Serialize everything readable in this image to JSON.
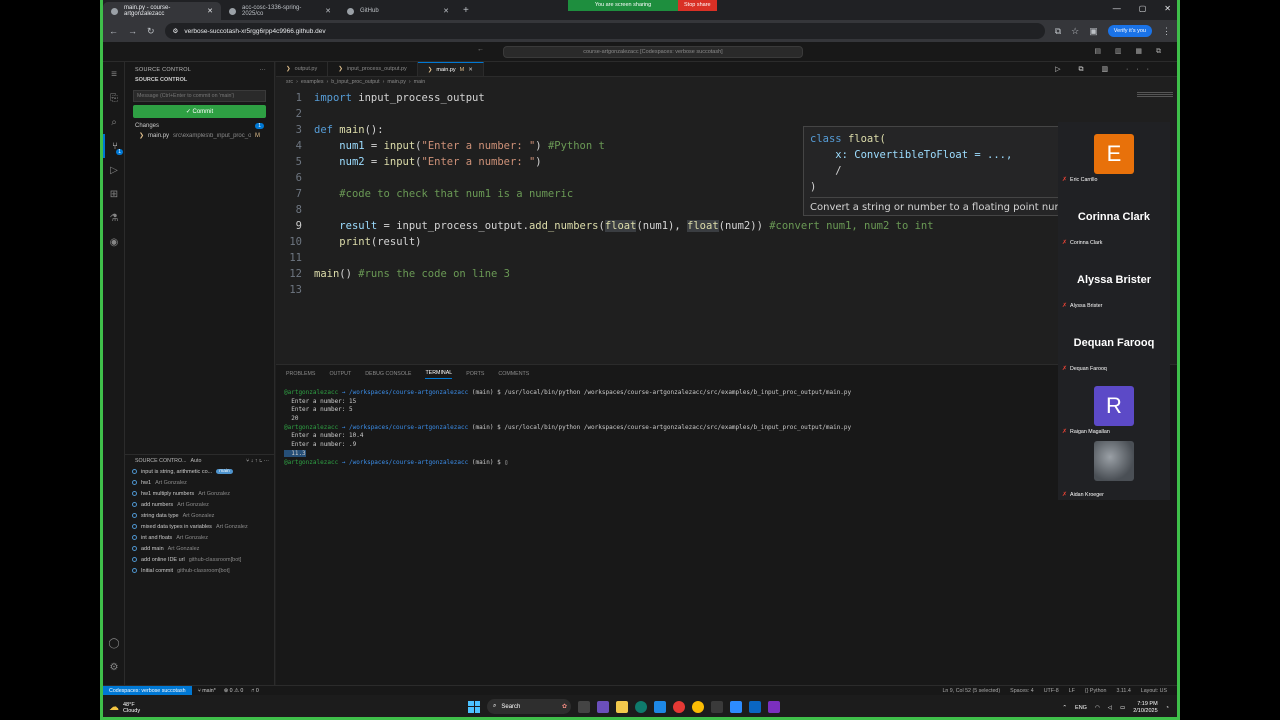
{
  "browser": {
    "tabs": [
      {
        "title": "main.py - course-artgonzalezacc",
        "active": true
      },
      {
        "title": "acc-cosc-1336-spring-2025/co",
        "active": false
      },
      {
        "title": "GitHub",
        "active": false
      }
    ],
    "share_text": "You are screen sharing",
    "stop_share": "Stop share",
    "url": "verbose-succotash-xr5rgg6rpp4c9966.github.dev",
    "verify": "Verify it's you"
  },
  "vscode": {
    "command_center": "course-artgonzalezacc [Codespaces: verbose succotash]",
    "source_control": {
      "header": "SOURCE CONTROL",
      "sub_header": "SOURCE CONTROL",
      "message_placeholder": "Message (Ctrl+Enter to commit on 'main')",
      "commit_label": "✓ Commit",
      "changes_label": "Changes",
      "changes_count": "1",
      "file_name": "main.py",
      "file_path": "src\\examples\\b_input_proc_out...",
      "file_status": "M"
    },
    "graph": {
      "header": "SOURCE CONTRO...",
      "auto_label": "Auto",
      "commits": [
        {
          "msg": "input is string, arithmetic co...",
          "author": "",
          "tag": "main"
        },
        {
          "msg": "hw1",
          "author": "Art Gonzalez",
          "tag": ""
        },
        {
          "msg": "hw1 multiply numbers",
          "author": "Art Gonzalez",
          "tag": ""
        },
        {
          "msg": "add numbers",
          "author": "Art Gonzalez",
          "tag": ""
        },
        {
          "msg": "string data type",
          "author": "Art Gonzalez",
          "tag": ""
        },
        {
          "msg": "mixed data types in variables",
          "author": "Art Gonzalez",
          "tag": ""
        },
        {
          "msg": "int and floats",
          "author": "Art Gonzalez",
          "tag": ""
        },
        {
          "msg": "add main",
          "author": "Art Gonzalez",
          "tag": ""
        },
        {
          "msg": "add online IDE url",
          "author": "github-classroom[bot]",
          "tag": ""
        },
        {
          "msg": "Initial commit",
          "author": "github-classroom[bot]",
          "tag": ""
        }
      ]
    },
    "editor_tabs": [
      {
        "label": "output.py",
        "modified": "",
        "active": false
      },
      {
        "label": "input_process_output.py",
        "modified": "",
        "active": false
      },
      {
        "label": "main.py",
        "modified": "M",
        "active": true
      }
    ],
    "breadcrumbs": [
      "src",
      "examples",
      "b_input_proc_output",
      "main.py",
      "main"
    ],
    "code_lines": [
      {
        "n": "1",
        "tokens": [
          [
            "kw",
            "import "
          ],
          [
            "tx",
            "input_process_output"
          ]
        ]
      },
      {
        "n": "2",
        "tokens": []
      },
      {
        "n": "3",
        "tokens": [
          [
            "kw",
            "def "
          ],
          [
            "fn",
            "main"
          ],
          [
            "tx",
            "():"
          ]
        ]
      },
      {
        "n": "4",
        "tokens": [
          [
            "tx",
            "    "
          ],
          [
            "vr",
            "num1"
          ],
          [
            "tx",
            " = "
          ],
          [
            "fn",
            "input"
          ],
          [
            "tx",
            "("
          ],
          [
            "st",
            "\"Enter a number: \""
          ],
          [
            "tx",
            ") "
          ],
          [
            "cm",
            "#Python t"
          ]
        ]
      },
      {
        "n": "5",
        "tokens": [
          [
            "tx",
            "    "
          ],
          [
            "vr",
            "num2"
          ],
          [
            "tx",
            " = "
          ],
          [
            "fn",
            "input"
          ],
          [
            "tx",
            "("
          ],
          [
            "st",
            "\"Enter a number: \""
          ],
          [
            "tx",
            ")"
          ]
        ]
      },
      {
        "n": "6",
        "tokens": []
      },
      {
        "n": "7",
        "tokens": [
          [
            "tx",
            "    "
          ],
          [
            "cm",
            "#code to check that num1 is a numeric"
          ]
        ]
      },
      {
        "n": "8",
        "tokens": []
      },
      {
        "n": "9",
        "tokens": [
          [
            "tx",
            "    "
          ],
          [
            "vr",
            "result"
          ],
          [
            "tx",
            " = "
          ],
          [
            "tx",
            "input_process_output"
          ],
          [
            "tx",
            "."
          ],
          [
            "fn",
            "add_numbers"
          ],
          [
            "tx",
            "("
          ],
          [
            "hl",
            "float"
          ],
          [
            "tx",
            "(num1), "
          ],
          [
            "hl",
            "float"
          ],
          [
            "tx",
            "(num2)) "
          ],
          [
            "cm",
            "#convert num1, num2 to int"
          ]
        ]
      },
      {
        "n": "10",
        "tokens": [
          [
            "tx",
            "    "
          ],
          [
            "fn",
            "print"
          ],
          [
            "tx",
            "(result)"
          ]
        ]
      },
      {
        "n": "11",
        "tokens": []
      },
      {
        "n": "12",
        "tokens": [
          [
            "fn",
            "main"
          ],
          [
            "tx",
            "() "
          ],
          [
            "cm",
            "#runs the code on line 3"
          ]
        ]
      },
      {
        "n": "13",
        "tokens": []
      }
    ],
    "hover": {
      "sig_lines": [
        "class float(",
        "    x: ConvertibleToFloat = ...,",
        "    /",
        ")"
      ],
      "doc": "Convert a string or number to a floating point number, if possible."
    },
    "panel_tabs": [
      "PROBLEMS",
      "OUTPUT",
      "DEBUG CONSOLE",
      "TERMINAL",
      "PORTS",
      "COMMENTS"
    ],
    "terminal": [
      {
        "user": "@artgonzalezacc",
        "path": "→ /workspaces/course-artgonzalezacc",
        "rest": " (main) $ /usr/local/bin/python /workspaces/course-artgonzalezacc/src/examples/b_input_proc_output/main.py"
      },
      {
        "text": "Enter a number: 15"
      },
      {
        "text": "Enter a number: 5"
      },
      {
        "text": "20"
      },
      {
        "user": "@artgonzalezacc",
        "path": "→ /workspaces/course-artgonzalezacc",
        "rest": " (main) $ /usr/local/bin/python /workspaces/course-artgonzalezacc/src/examples/b_input_proc_output/main.py"
      },
      {
        "text": "Enter a number: 10.4"
      },
      {
        "text": "Enter a number: .9"
      },
      {
        "text": "11.3",
        "selected": true
      },
      {
        "user": "@artgonzalezacc",
        "path": "→ /workspaces/course-artgonzalezacc",
        "rest": " (main) $ ▯"
      }
    ],
    "status": {
      "remote": "Codespaces: verbose succotash",
      "branch": "main*",
      "problems": "⊗ 0 ⚠ 0",
      "ports": "⑁ 0",
      "right": [
        "Ln 9, Col 52 (5 selected)",
        "Spaces: 4",
        "UTF-8",
        "LF",
        "{} Python",
        "3.11.4",
        "Layout: US"
      ]
    }
  },
  "participants": [
    {
      "big": "E",
      "name": "Eric Carrillo",
      "color": "#e8710a",
      "kind": "avatar"
    },
    {
      "big": "Corinna Clark",
      "name": "Corinna Clark",
      "kind": "text"
    },
    {
      "big": "Alyssa Brister",
      "name": "Alyssa Brister",
      "kind": "text"
    },
    {
      "big": "Dequan Farooq",
      "name": "Dequan Farooq",
      "kind": "text"
    },
    {
      "big": "R",
      "name": "Raigan Magallan",
      "color": "#5c4ac7",
      "kind": "avatar"
    },
    {
      "big": "",
      "name": "Aidan Kroeger",
      "kind": "photo"
    }
  ],
  "taskbar": {
    "temp": "48°F",
    "weather": "Cloudy",
    "search": "Search",
    "lang": "ENG",
    "time": "7:19 PM",
    "date": "2/10/2025"
  }
}
